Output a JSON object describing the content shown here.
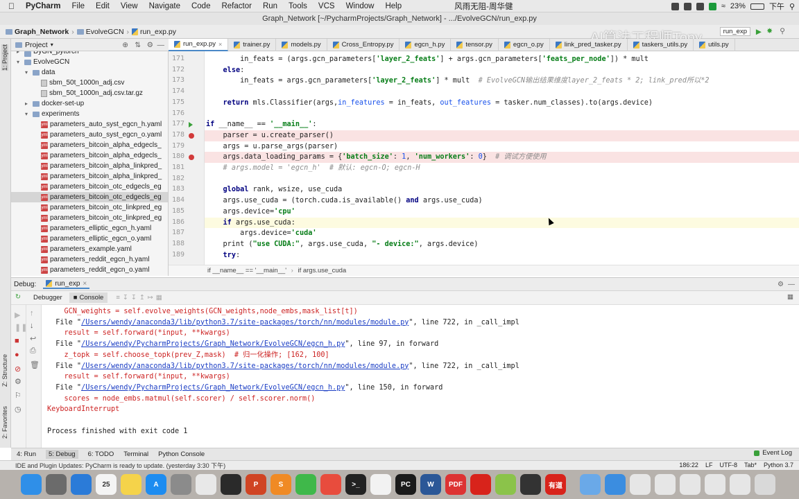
{
  "menubar": {
    "app": "PyCharm",
    "items": [
      "File",
      "Edit",
      "View",
      "Navigate",
      "Code",
      "Refactor",
      "Run",
      "Tools",
      "VCS",
      "Window",
      "Help"
    ],
    "center_text": "风雨无阻-周华健",
    "battery": "23%",
    "clock_partial": "下午"
  },
  "window_title": "Graph_Network [~/PycharmProjects/Graph_Network] - .../EvolveGCN/run_exp.py",
  "navbar": {
    "crumbs": [
      "Graph_Network",
      "EvolveGCN",
      "run_exp.py"
    ],
    "run_config": "run_exp"
  },
  "watermark": "AI算法工程师Tony",
  "left_tool": {
    "project": "1: Project",
    "structure": "Z: Structure",
    "favorites": "2: Favorites"
  },
  "project_panel": {
    "title": "Project",
    "items": [
      {
        "label": "DyGN_pytorch",
        "indent": 1,
        "kind": "folder",
        "arrow": "▸"
      },
      {
        "label": "EvolveGCN",
        "indent": 1,
        "kind": "folder",
        "arrow": "▾"
      },
      {
        "label": "data",
        "indent": 2,
        "kind": "folder",
        "arrow": "▾"
      },
      {
        "label": "sbm_50t_1000n_adj.csv",
        "indent": 3,
        "kind": "file",
        "arrow": ""
      },
      {
        "label": "sbm_50t_1000n_adj.csv.tar.gz",
        "indent": 3,
        "kind": "file",
        "arrow": ""
      },
      {
        "label": "docker-set-up",
        "indent": 2,
        "kind": "folder",
        "arrow": "▸"
      },
      {
        "label": "experiments",
        "indent": 2,
        "kind": "folder",
        "arrow": "▾"
      },
      {
        "label": "parameters_auto_syst_egcn_h.yaml",
        "indent": 3,
        "kind": "yml",
        "arrow": ""
      },
      {
        "label": "parameters_auto_syst_egcn_o.yaml",
        "indent": 3,
        "kind": "yml",
        "arrow": ""
      },
      {
        "label": "parameters_bitcoin_alpha_edgecls_",
        "indent": 3,
        "kind": "yml",
        "arrow": ""
      },
      {
        "label": "parameters_bitcoin_alpha_edgecls_",
        "indent": 3,
        "kind": "yml",
        "arrow": ""
      },
      {
        "label": "parameters_bitcoin_alpha_linkpred_",
        "indent": 3,
        "kind": "yml",
        "arrow": ""
      },
      {
        "label": "parameters_bitcoin_alpha_linkpred_",
        "indent": 3,
        "kind": "yml",
        "arrow": ""
      },
      {
        "label": "parameters_bitcoin_otc_edgecls_eg",
        "indent": 3,
        "kind": "yml",
        "arrow": ""
      },
      {
        "label": "parameters_bitcoin_otc_edgecls_eg",
        "indent": 3,
        "kind": "yml",
        "arrow": "",
        "selected": true
      },
      {
        "label": "parameters_bitcoin_otc_linkpred_eg",
        "indent": 3,
        "kind": "yml",
        "arrow": ""
      },
      {
        "label": "parameters_bitcoin_otc_linkpred_eg",
        "indent": 3,
        "kind": "yml",
        "arrow": ""
      },
      {
        "label": "parameters_elliptic_egcn_h.yaml",
        "indent": 3,
        "kind": "yml",
        "arrow": ""
      },
      {
        "label": "parameters_elliptic_egcn_o.yaml",
        "indent": 3,
        "kind": "yml",
        "arrow": ""
      },
      {
        "label": "parameters_example.yaml",
        "indent": 3,
        "kind": "yml",
        "arrow": ""
      },
      {
        "label": "parameters_reddit_egcn_h.yaml",
        "indent": 3,
        "kind": "yml",
        "arrow": ""
      },
      {
        "label": "parameters_reddit_egcn_o.yaml",
        "indent": 3,
        "kind": "yml",
        "arrow": ""
      }
    ]
  },
  "tabs": [
    "run_exp.py",
    "trainer.py",
    "models.py",
    "Cross_Entropy.py",
    "egcn_h.py",
    "tensor.py",
    "egcn_o.py",
    "link_pred_tasker.py",
    "taskers_utils.py",
    "utils.py"
  ],
  "editor": {
    "lines": [
      {
        "n": "171",
        "html": "        <span>in_feats = (args.gcn_parameters[</span><span class=\"str\">'layer_2_feats'</span><span>] + args.gcn_parameters[</span><span class=\"str\">'feats_per_node'</span><span>]) * mult</span>",
        "cls": ""
      },
      {
        "n": "172",
        "html": "    <span class=\"kw\">else</span>:",
        "cls": ""
      },
      {
        "n": "173",
        "html": "        in_feats = args.gcn_parameters[<span class=\"str\">'layer_2_feats'</span>] * mult  <span class=\"cm\"># EvolveGCN输出结果维度layer_2_feats * 2; link_pred所以*2</span>",
        "cls": ""
      },
      {
        "n": "174",
        "html": "",
        "cls": ""
      },
      {
        "n": "175",
        "html": "    <span class=\"kw\">return</span> mls.Classifier(args,<span class=\"num\">in_features</span> = in_feats, <span class=\"num\">out_features</span> = tasker.num_classes).to(args.device)",
        "cls": ""
      },
      {
        "n": "176",
        "html": "",
        "cls": ""
      },
      {
        "n": "177",
        "html": "<span class=\"kw\">if</span> __name__ == <span class=\"str\">'__main__'</span>:",
        "cls": ""
      },
      {
        "n": "178",
        "html": "    parser = u.create_parser()",
        "cls": "bp"
      },
      {
        "n": "179",
        "html": "    args = u.parse_args(parser)",
        "cls": ""
      },
      {
        "n": "180",
        "html": "    args.data_loading_params = {<span class=\"str\">'batch_size'</span>: <span class=\"num\">1</span>, <span class=\"str\">'num_workers'</span>: <span class=\"num\">0</span>}  <span class=\"cm\"># 调试方便使用</span>",
        "cls": "bp"
      },
      {
        "n": "181",
        "html": "    <span class=\"cm\"># args.model = 'egcn_h'  # 默认: egcn-O; egcn-H</span>",
        "cls": ""
      },
      {
        "n": "182",
        "html": "",
        "cls": ""
      },
      {
        "n": "183",
        "html": "    <span class=\"kw\">global</span> rank, wsize, use_cuda",
        "cls": ""
      },
      {
        "n": "184",
        "html": "    args.use_cuda = (torch.cuda.is_available() <span class=\"kw\">and</span> args.use_cuda)",
        "cls": ""
      },
      {
        "n": "185",
        "html": "    args.device=<span class=\"str\">'cpu'</span>",
        "cls": ""
      },
      {
        "n": "186",
        "html": "    <span class=\"kw\">if</span> args.use_cuda:",
        "cls": "cur"
      },
      {
        "n": "187",
        "html": "        args.device=<span class=\"str\">'cuda'</span>",
        "cls": ""
      },
      {
        "n": "188",
        "html": "    print (<span class=\"str\">\"use CUDA:\"</span>, args.use_cuda, <span class=\"str\">\"- device:\"</span>, args.device)",
        "cls": ""
      },
      {
        "n": "189",
        "html": "    <span class=\"kw\">try</span>:",
        "cls": ""
      }
    ]
  },
  "breadcrumb": [
    "if __name__ == '__main__'",
    "if args.use_cuda"
  ],
  "debug": {
    "label": "Debug:",
    "config": "run_exp",
    "tabs": [
      "Debugger",
      "Console"
    ]
  },
  "console": [
    {
      "t": "plain",
      "text": "    GCN_weights = self.evolve_weights(GCN_weights,node_embs,mask_list[t])",
      "red": true
    },
    {
      "t": "file",
      "pre": "  File \"",
      "link": "/Users/wendy/anaconda3/lib/python3.7/site-packages/torch/nn/modules/module.py",
      "post": "\", line 722, in _call_impl"
    },
    {
      "t": "plain",
      "text": "    result = self.forward(*input, **kwargs)",
      "red": true
    },
    {
      "t": "file",
      "pre": "  File \"",
      "link": "/Users/wendy/PycharmProjects/Graph_Network/EvolveGCN/egcn_h.py",
      "post": "\", line 97, in forward"
    },
    {
      "t": "plain",
      "text": "    z_topk = self.choose_topk(prev_Z,mask)  # 归一化操作; [162, 100]",
      "red": true
    },
    {
      "t": "file",
      "pre": "  File \"",
      "link": "/Users/wendy/anaconda3/lib/python3.7/site-packages/torch/nn/modules/module.py",
      "post": "\", line 722, in _call_impl"
    },
    {
      "t": "plain",
      "text": "    result = self.forward(*input, **kwargs)",
      "red": true
    },
    {
      "t": "file",
      "pre": "  File \"",
      "link": "/Users/wendy/PycharmProjects/Graph_Network/EvolveGCN/egcn_h.py",
      "post": "\", line 150, in forward"
    },
    {
      "t": "plain",
      "text": "    scores = node_embs.matmul(self.scorer) / self.scorer.norm()",
      "red": true
    },
    {
      "t": "plain",
      "text": "KeyboardInterrupt",
      "red": true
    },
    {
      "t": "plain",
      "text": "",
      "red": false
    },
    {
      "t": "plain",
      "text": "Process finished with exit code 1",
      "red": false
    }
  ],
  "bottom_tools": [
    "4: Run",
    "5: Debug",
    "6: TODO",
    "Terminal",
    "Python Console"
  ],
  "event_log": "Event Log",
  "status": {
    "message": "IDE and Plugin Updates: PyCharm is ready to update. (yesterday 3:30 下午)",
    "right": [
      "186:22",
      "LF",
      "UTF-8",
      "Tab*",
      "Python 3.7"
    ]
  },
  "dock": {
    "icons": [
      {
        "name": "finder-icon",
        "color": "#2f8fe8",
        "t": ""
      },
      {
        "name": "launchpad-icon",
        "color": "#6b6b6b",
        "t": ""
      },
      {
        "name": "safari-icon",
        "color": "#2b7bd8",
        "t": ""
      },
      {
        "name": "calendar-icon",
        "color": "#f4f4f4",
        "t": "25"
      },
      {
        "name": "notes-icon",
        "color": "#f5d34a",
        "t": ""
      },
      {
        "name": "appstore-icon",
        "color": "#1d8cf0",
        "t": "A"
      },
      {
        "name": "settings-icon",
        "color": "#8b8b8b",
        "t": ""
      },
      {
        "name": "preview-icon",
        "color": "#e8e8e8",
        "t": ""
      },
      {
        "name": "activity-icon",
        "color": "#2a2a2a",
        "t": ""
      },
      {
        "name": "powerpoint-icon",
        "color": "#d04423",
        "t": "P"
      },
      {
        "name": "sublime-icon",
        "color": "#f08a24",
        "t": "S"
      },
      {
        "name": "wechat-icon",
        "color": "#3fb84a",
        "t": ""
      },
      {
        "name": "chrome-icon",
        "color": "#e84c3d",
        "t": ""
      },
      {
        "name": "terminal-icon",
        "color": "#222",
        "t": ">_"
      },
      {
        "name": "baidu-icon",
        "color": "#f2f2f2",
        "t": ""
      },
      {
        "name": "pycharm-icon",
        "color": "#1b1b1b",
        "t": "PC"
      },
      {
        "name": "word-icon",
        "color": "#2b5797",
        "t": "W"
      },
      {
        "name": "pdf-icon",
        "color": "#d33",
        "t": "PDF"
      },
      {
        "name": "netease-icon",
        "color": "#d8231b",
        "t": ""
      },
      {
        "name": "maps-icon",
        "color": "#8bc34a",
        "t": ""
      },
      {
        "name": "facetime-icon",
        "color": "#333",
        "t": ""
      },
      {
        "name": "youdao-icon",
        "color": "#d8231b",
        "t": "有道"
      },
      {
        "name": "folder-icon",
        "color": "#6aa9e8",
        "t": ""
      },
      {
        "name": "download-icon",
        "color": "#3b8de0",
        "t": ""
      },
      {
        "name": "window-icon-a",
        "color": "#e6e6e6",
        "t": ""
      },
      {
        "name": "window-icon-b",
        "color": "#e6e6e6",
        "t": ""
      },
      {
        "name": "window-icon-c",
        "color": "#e6e6e6",
        "t": ""
      },
      {
        "name": "window-icon-d",
        "color": "#e6e6e6",
        "t": ""
      },
      {
        "name": "window-icon-e",
        "color": "#e6e6e6",
        "t": ""
      },
      {
        "name": "trash-icon",
        "color": "#d9d9d9",
        "t": ""
      }
    ],
    "calendar_badge": "25"
  }
}
